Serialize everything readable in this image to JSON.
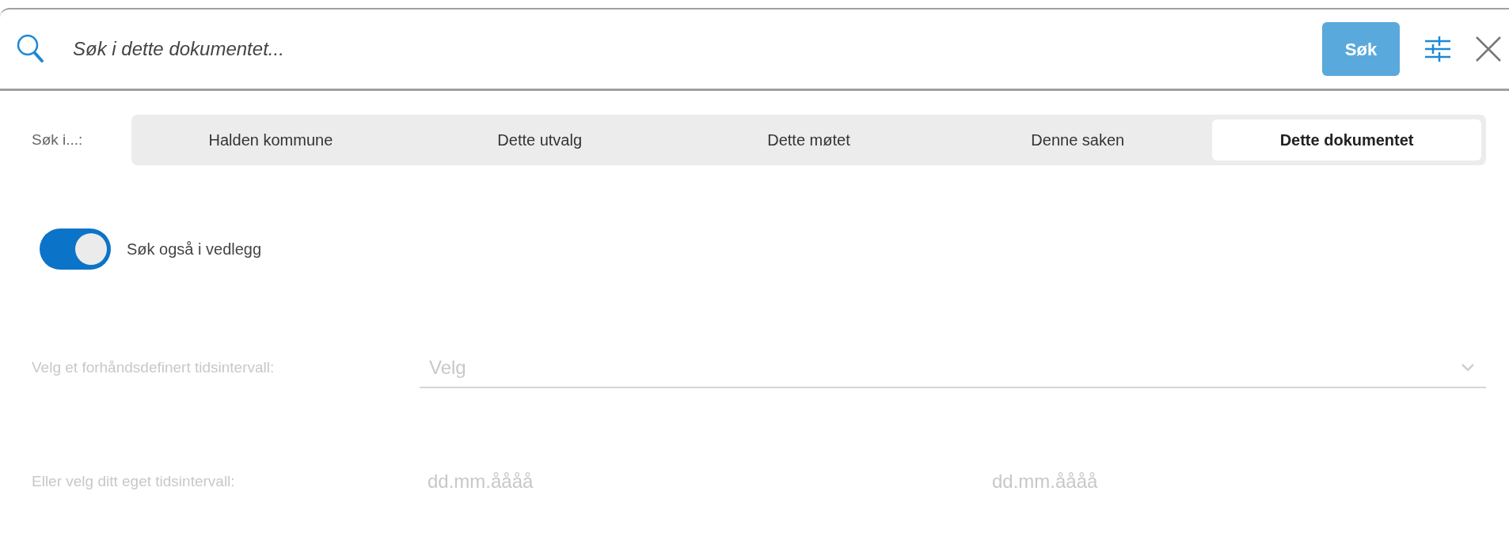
{
  "search": {
    "placeholder": "Søk i dette dokumentet...",
    "button": "Søk"
  },
  "scope": {
    "label": "Søk i...:",
    "tabs": [
      {
        "label": "Halden kommune",
        "selected": false
      },
      {
        "label": "Dette utvalg",
        "selected": false
      },
      {
        "label": "Dette møtet",
        "selected": false
      },
      {
        "label": "Denne saken",
        "selected": false
      },
      {
        "label": "Dette dokumentet",
        "selected": true
      }
    ]
  },
  "attachments_toggle": {
    "label": "Søk også i vedlegg",
    "on": true
  },
  "preset_interval": {
    "label": "Velg et forhåndsdefinert tidsintervall:",
    "placeholder": "Velg",
    "disabled": true
  },
  "custom_interval": {
    "label": "Eller velg ditt eget tidsintervall:",
    "disabled": true,
    "from": {
      "placeholder": "dd.mm.åååå"
    },
    "to": {
      "placeholder": "dd.mm.åååå"
    }
  }
}
